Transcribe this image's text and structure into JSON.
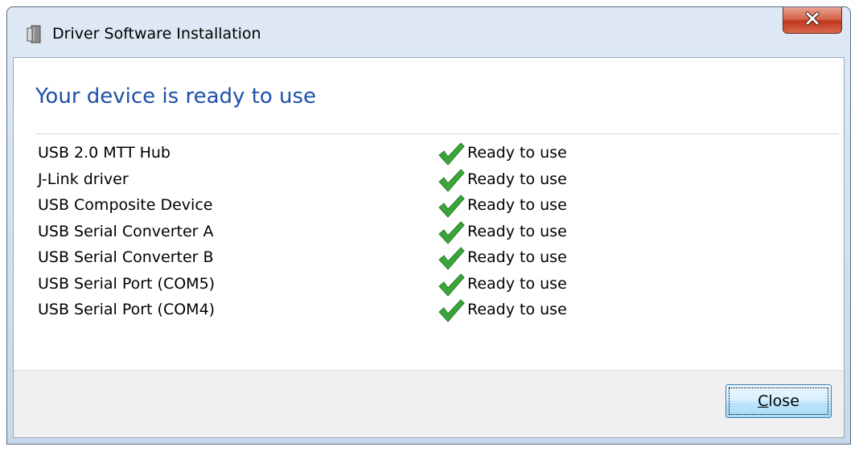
{
  "window": {
    "title": "Driver Software Installation",
    "icon": "driver-install-icon",
    "close_icon": "close-icon"
  },
  "main": {
    "heading": "Your device is ready to use",
    "status_icon": "green-checkmark-icon",
    "devices": [
      {
        "name": "USB 2.0 MTT Hub",
        "status": "Ready to use"
      },
      {
        "name": "J-Link driver",
        "status": "Ready to use"
      },
      {
        "name": "USB Composite Device",
        "status": "Ready to use"
      },
      {
        "name": "USB Serial Converter A",
        "status": "Ready to use"
      },
      {
        "name": "USB Serial Converter B",
        "status": "Ready to use"
      },
      {
        "name": "USB Serial Port (COM5)",
        "status": "Ready to use"
      },
      {
        "name": "USB Serial Port (COM4)",
        "status": "Ready to use"
      }
    ]
  },
  "footer": {
    "close_button": {
      "accelerator": "C",
      "rest": "lose"
    }
  },
  "colors": {
    "heading": "#1e4fa8",
    "check": "#3aa53a",
    "close_x": "#c1381d"
  }
}
